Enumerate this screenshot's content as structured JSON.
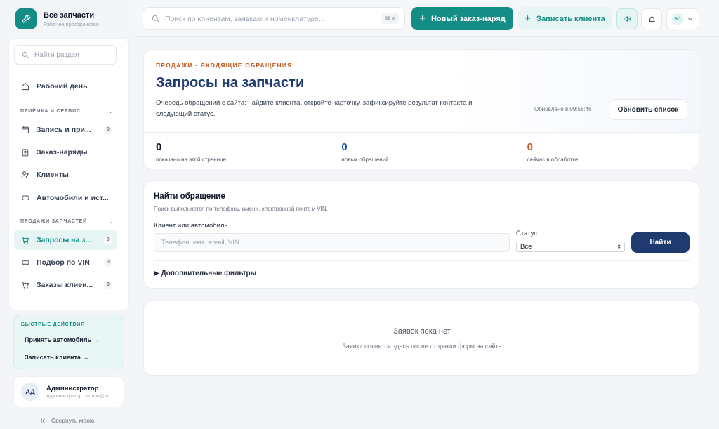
{
  "colors": {
    "accent": "#138d86",
    "navy": "#1f3a6e",
    "eyebrow": "#c2581b",
    "stat_new": "#1f5aa6",
    "stat_work": "#c2581b"
  },
  "brand": {
    "title": "Все запчасти",
    "subtitle": "Рабочее пространство",
    "icon": "wrench-icon"
  },
  "sidebar": {
    "search_placeholder": "Найти раздел",
    "top_item": {
      "label": "Рабочий день",
      "icon": "home-icon"
    },
    "sections": [
      {
        "title": "ПРИЁМКА И СЕРВИС",
        "items": [
          {
            "label": "Запись и при...",
            "icon": "calendar-icon",
            "count": "0"
          },
          {
            "label": "Заказ-наряды",
            "icon": "clipboard-icon"
          },
          {
            "label": "Клиенты",
            "icon": "user-plus-icon"
          },
          {
            "label": "Автомобили и ист...",
            "icon": "car-icon"
          }
        ]
      },
      {
        "title": "ПРОДАЖИ ЗАПЧАСТЕЙ",
        "items": [
          {
            "label": "Запросы на з...",
            "icon": "cart-icon",
            "count": "0",
            "active": true
          },
          {
            "label": "Подбор по VIN",
            "icon": "car-icon",
            "count": "0"
          },
          {
            "label": "Заказы клиен...",
            "icon": "cart-icon",
            "count": "0"
          }
        ]
      }
    ],
    "quick_actions": {
      "title": "БЫСТРЫЕ ДЕЙСТВИЯ",
      "links": [
        "Принять автомобиль →",
        "Записать клиента →"
      ]
    },
    "user": {
      "initials": "АД",
      "name": "Администратор",
      "role": "Администратор · admin@lo..."
    },
    "collapse_label": "Свернуть меню"
  },
  "topbar": {
    "search_placeholder": "Поиск по клиентам, заявкам и номенклатуре...",
    "shortcut": "⌘ K",
    "new_order_label": "Новый заказ-наряд",
    "book_client_label": "Записать клиента",
    "user_initials": "ВС"
  },
  "hero": {
    "eyebrow": "ПРОДАЖИ · ВХОДЯЩИЕ ОБРАЩЕНИЯ",
    "title": "Запросы на запчасти",
    "description": "Очередь обращений с сайта: найдите клиента, откройте карточку, зафиксируйте результат контакта и следующий статус.",
    "updated": "Обновлено в 09:58:46",
    "refresh_label": "Обновить список",
    "stats": [
      {
        "value": "0",
        "label": "показано на этой странице"
      },
      {
        "value": "0",
        "label": "новых обращений"
      },
      {
        "value": "0",
        "label": "сейчас в обработке"
      }
    ]
  },
  "search": {
    "title": "Найти обращение",
    "subtitle": "Поиск выполняется по телефону, имени, электронной почте и VIN.",
    "client_label": "Клиент или автомобиль",
    "client_placeholder": "Телефон, имя, email, VIN",
    "status_label": "Статус",
    "status_value": "Все",
    "find_label": "Найти",
    "more_filters": "▶ Дополнительные фильтры"
  },
  "empty": {
    "title": "Заявок пока нет",
    "subtitle": "Заявки появятся здесь после отправки форм на сайте"
  }
}
